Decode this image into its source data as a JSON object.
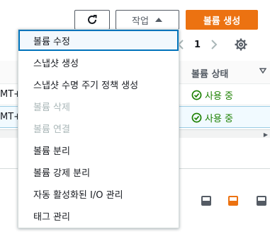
{
  "toolbar": {
    "refresh_icon": "refresh-icon",
    "actions_label": "작업",
    "create_label": "볼륨 생성"
  },
  "pagination": {
    "page": "1"
  },
  "table": {
    "header_status": "볼륨 상태",
    "rows": [
      {
        "left_fragment": "MT+",
        "status": "사용 중"
      },
      {
        "left_fragment": "MT+",
        "status": "사용 중"
      }
    ]
  },
  "menu": {
    "items": [
      {
        "label": "볼륨 수정",
        "state": "focused"
      },
      {
        "label": "스냅샷 생성",
        "state": "enabled"
      },
      {
        "label": "스냅샷 수명 주기 정책 생성",
        "state": "enabled"
      },
      {
        "label": "볼륨 삭제",
        "state": "disabled"
      },
      {
        "label": "볼륨 연결",
        "state": "disabled"
      },
      {
        "label": "볼륨 분리",
        "state": "enabled"
      },
      {
        "label": "볼륨 강제 분리",
        "state": "enabled"
      },
      {
        "label": "자동 활성화된 I/O 관리",
        "state": "enabled"
      },
      {
        "label": "태그 관리",
        "state": "enabled"
      }
    ]
  },
  "colors": {
    "accent": "#ec7211",
    "focus": "#0073bb",
    "success": "#1d8102"
  }
}
